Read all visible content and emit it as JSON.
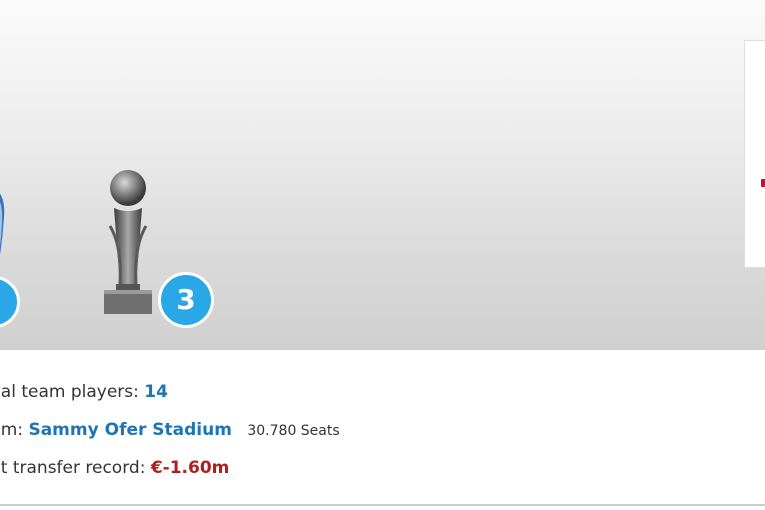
{
  "trophies": {
    "badge_count": "3",
    "accent_color": "#2aa7e6"
  },
  "info": {
    "national_players_label": "nal team players:",
    "national_players_value": "14",
    "stadium_label": "um:",
    "stadium_name": "Sammy Ofer Stadium",
    "stadium_seats": "30.780 Seats",
    "transfer_label": "nt transfer record:",
    "transfer_value": "€-1.60m"
  },
  "colors": {
    "link_blue": "#1d75b3",
    "negative_red": "#b21e1e"
  }
}
